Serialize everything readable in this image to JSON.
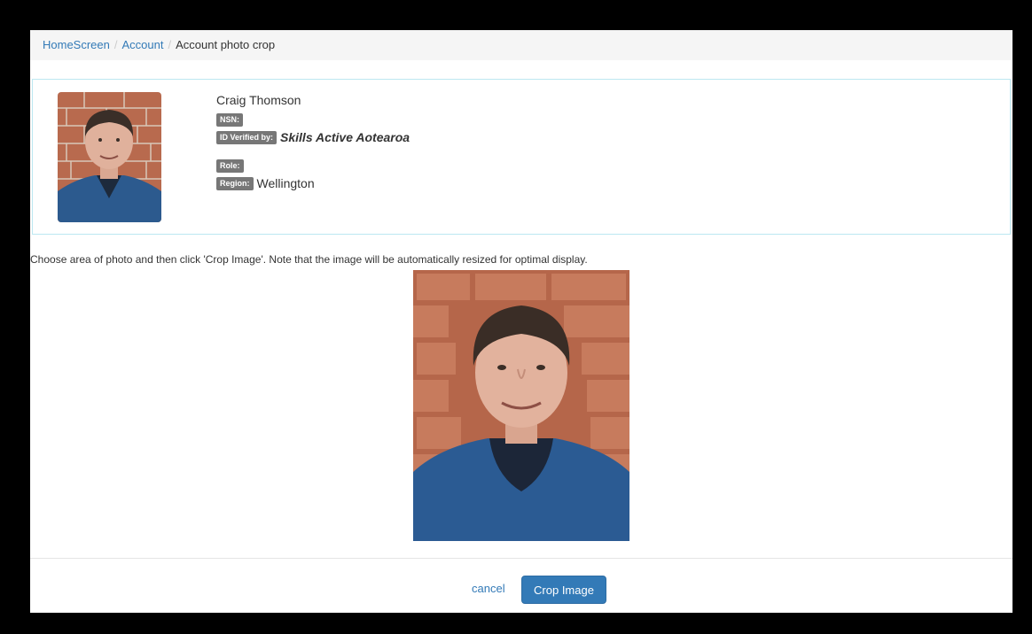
{
  "breadcrumb": {
    "home": "HomeScreen",
    "account": "Account",
    "current": "Account photo crop"
  },
  "profile": {
    "name": "Craig Thomson",
    "nsn_label": "NSN:",
    "nsn_value": "",
    "id_verified_label": "ID Verified by:",
    "id_verified_value": "Skills Active Aotearoa",
    "role_label": "Role:",
    "role_value": "",
    "region_label": "Region:",
    "region_value": "Wellington"
  },
  "instructions": "Choose area of photo and then click 'Crop Image'. Note that the image will be automatically resized for optimal display.",
  "footer": {
    "cancel_label": "cancel",
    "crop_label": "Crop Image"
  },
  "colors": {
    "link": "#337ab7",
    "primary_button": "#337ab7",
    "panel_border": "#bce8f1",
    "badge": "#777777"
  }
}
